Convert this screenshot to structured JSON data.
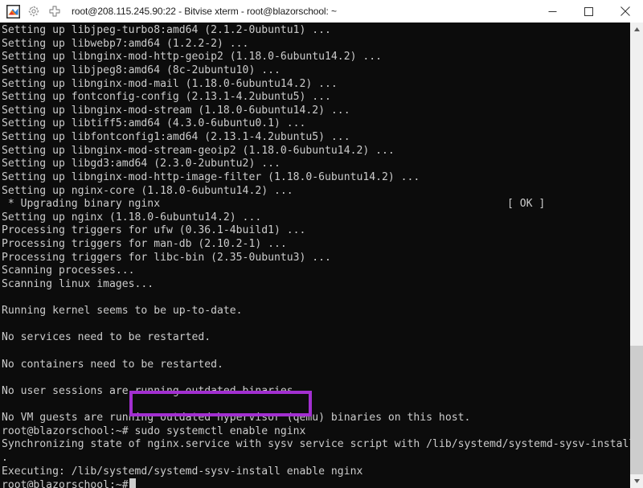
{
  "window": {
    "title": "root@208.115.245.90:22 - Bitvise xterm - root@blazorschool: ~",
    "icons": {
      "app": "bitvise-app-icon",
      "gear": "gear-icon",
      "plus": "plus-icon"
    },
    "controls": {
      "minimize": "minimize-button",
      "maximize": "maximize-button",
      "close": "close-button"
    }
  },
  "theme": {
    "titlebar_bg": "#ffffff",
    "titlebar_text": "#1d1d1d",
    "terminal_bg": "#0c0c0c",
    "terminal_fg": "#cccccc",
    "highlight_border": "#a22fd0",
    "scrollbar_track": "#f0f0f0",
    "scrollbar_thumb": "#cdcdcd"
  },
  "terminal": {
    "status_tag": "[ OK ]",
    "prompt": "root@blazorschool:~#",
    "highlighted_command": "sudo systemctl enable nginx",
    "lines": [
      "Setting up libjpeg-turbo8:amd64 (2.1.2-0ubuntu1) ...",
      "Setting up libwebp7:amd64 (1.2.2-2) ...",
      "Setting up libnginx-mod-http-geoip2 (1.18.0-6ubuntu14.2) ...",
      "Setting up libjpeg8:amd64 (8c-2ubuntu10) ...",
      "Setting up libnginx-mod-mail (1.18.0-6ubuntu14.2) ...",
      "Setting up fontconfig-config (2.13.1-4.2ubuntu5) ...",
      "Setting up libnginx-mod-stream (1.18.0-6ubuntu14.2) ...",
      "Setting up libtiff5:amd64 (4.3.0-6ubuntu0.1) ...",
      "Setting up libfontconfig1:amd64 (2.13.1-4.2ubuntu5) ...",
      "Setting up libnginx-mod-stream-geoip2 (1.18.0-6ubuntu14.2) ...",
      "Setting up libgd3:amd64 (2.3.0-2ubuntu2) ...",
      "Setting up libnginx-mod-http-image-filter (1.18.0-6ubuntu14.2) ...",
      "Setting up nginx-core (1.18.0-6ubuntu14.2) ...",
      " * Upgrading binary nginx",
      "Setting up nginx (1.18.0-6ubuntu14.2) ...",
      "Processing triggers for ufw (0.36.1-4build1) ...",
      "Processing triggers for man-db (2.10.2-1) ...",
      "Processing triggers for libc-bin (2.35-0ubuntu3) ...",
      "Scanning processes...",
      "Scanning linux images...",
      "",
      "Running kernel seems to be up-to-date.",
      "",
      "No services need to be restarted.",
      "",
      "No containers need to be restarted.",
      "",
      "No user sessions are running outdated binaries.",
      "",
      "No VM guests are running outdated hypervisor (qemu) binaries on this host.",
      "root@blazorschool:~# sudo systemctl enable nginx",
      "Synchronizing state of nginx.service with sysv service script with /lib/systemd/systemd-sysv-install",
      ".",
      "Executing: /lib/systemd/systemd-sysv-install enable nginx",
      "root@blazorschool:~#"
    ],
    "ok_line_index": 13
  },
  "scrollbar": {
    "up_arrow": "scroll-up-arrow-icon",
    "down_arrow": "scroll-down-arrow-icon"
  }
}
